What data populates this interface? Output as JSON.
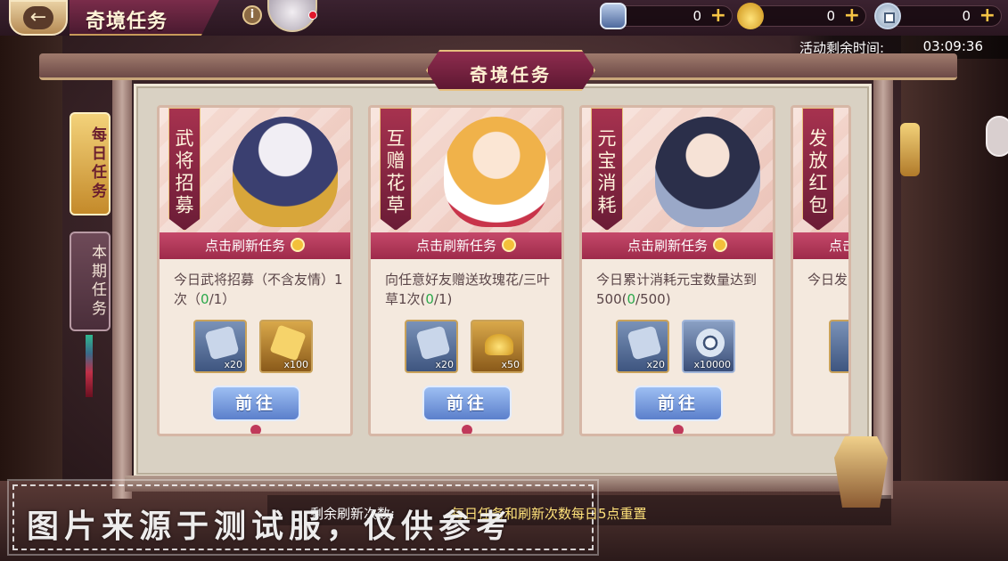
{
  "header": {
    "back_icon": "back-arrow-icon",
    "title": "奇境任务",
    "info_icon": "info-icon",
    "currencies": [
      {
        "icon": "active-tag-icon",
        "value": "0"
      },
      {
        "icon": "gold-ingot-icon",
        "value": "0"
      },
      {
        "icon": "silver-coin-icon",
        "value": "0"
      }
    ],
    "timer_label": "活动剩余时间:",
    "timer_value": "03:09:36"
  },
  "panel": {
    "banner_title": "奇境任务"
  },
  "side_tabs": [
    {
      "label": "每日任务",
      "active": true
    },
    {
      "label": "本期任务",
      "active": false
    }
  ],
  "cards": [
    {
      "name": "武将招募",
      "refresh_label": "点击刷新任务",
      "desc_text": "今日武将招募（不含友情）1次（",
      "progress_done": "0",
      "progress_total": "/1）",
      "rewards": [
        {
          "icon": "active-tag-icon",
          "count": "x20"
        },
        {
          "icon": "jade-token-icon",
          "count": "x100"
        }
      ],
      "button": "前往"
    },
    {
      "name": "互赠花草",
      "refresh_label": "点击刷新任务",
      "desc_text": "向任意好友赠送玫瑰花/三叶草1次(",
      "progress_done": "0",
      "progress_total": "/1)",
      "rewards": [
        {
          "icon": "active-tag-icon",
          "count": "x20"
        },
        {
          "icon": "gold-ingot-icon",
          "count": "x50"
        }
      ],
      "button": "前往"
    },
    {
      "name": "元宝消耗",
      "refresh_label": "点击刷新任务",
      "desc_text": "今日累计消耗元宝数量达到500(",
      "progress_done": "0",
      "progress_total": "/500)",
      "rewards": [
        {
          "icon": "active-tag-icon",
          "count": "x20"
        },
        {
          "icon": "silver-coin-icon",
          "count": "x10000"
        }
      ],
      "button": "前往"
    },
    {
      "name": "发放红包",
      "refresh_label": "点击",
      "desc_text": "今日发"
    }
  ],
  "footer": {
    "refresh_count_label": "剩余刷新次数:",
    "reset_note": "每日任务和刷新次数每日5点重置"
  },
  "watermark": "图片来源于测试服，仅供参考",
  "colors": {
    "accent_crimson": "#9e2a4a",
    "button_blue": "#5b7fcb",
    "progress_green": "#2aa84a",
    "gold": "#f6c445"
  }
}
